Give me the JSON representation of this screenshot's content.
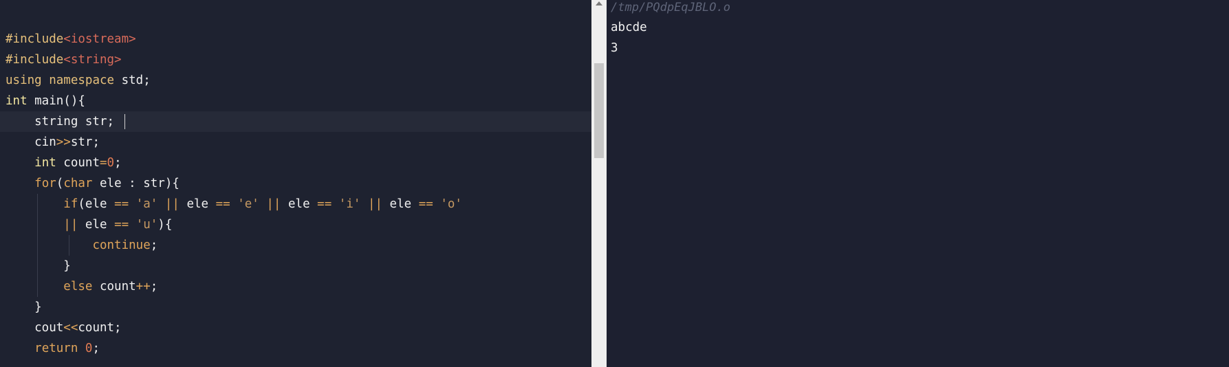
{
  "editor": {
    "lines": [
      [
        {
          "t": "#include",
          "c": "pp"
        },
        {
          "t": "<iostream>",
          "c": "inc"
        }
      ],
      [
        {
          "t": "#include",
          "c": "pp"
        },
        {
          "t": "<string>",
          "c": "inc"
        }
      ],
      [
        {
          "t": "using",
          "c": "kw-y"
        },
        {
          "t": " ",
          "c": "kw-w"
        },
        {
          "t": "namespace",
          "c": "kw-y"
        },
        {
          "t": " std;",
          "c": "kw-w"
        }
      ],
      [
        {
          "t": "int",
          "c": "tp"
        },
        {
          "t": " main(){",
          "c": "kw-w"
        }
      ],
      [
        {
          "t": "    string str;",
          "c": "kw-w"
        }
      ],
      [
        {
          "t": "    cin",
          "c": "kw-w"
        },
        {
          "t": ">>",
          "c": "op"
        },
        {
          "t": "str;",
          "c": "kw-w"
        }
      ],
      [
        {
          "t": "    ",
          "c": "kw-w"
        },
        {
          "t": "int",
          "c": "tp"
        },
        {
          "t": " count",
          "c": "kw-w"
        },
        {
          "t": "=",
          "c": "op"
        },
        {
          "t": "0",
          "c": "num"
        },
        {
          "t": ";",
          "c": "kw-w"
        }
      ],
      [
        {
          "t": "    ",
          "c": "kw-w"
        },
        {
          "t": "for",
          "c": "kw-o"
        },
        {
          "t": "(",
          "c": "kw-w"
        },
        {
          "t": "char",
          "c": "kw-o"
        },
        {
          "t": " ele : str){",
          "c": "kw-w"
        }
      ],
      [
        {
          "t": "        ",
          "c": "kw-w"
        },
        {
          "t": "if",
          "c": "kw-o"
        },
        {
          "t": "(ele ",
          "c": "kw-w"
        },
        {
          "t": "==",
          "c": "op"
        },
        {
          "t": " ",
          "c": "kw-w"
        },
        {
          "t": "'a'",
          "c": "str"
        },
        {
          "t": " ",
          "c": "kw-w"
        },
        {
          "t": "||",
          "c": "op"
        },
        {
          "t": " ele ",
          "c": "kw-w"
        },
        {
          "t": "==",
          "c": "op"
        },
        {
          "t": " ",
          "c": "kw-w"
        },
        {
          "t": "'e'",
          "c": "str"
        },
        {
          "t": " ",
          "c": "kw-w"
        },
        {
          "t": "||",
          "c": "op"
        },
        {
          "t": " ele ",
          "c": "kw-w"
        },
        {
          "t": "==",
          "c": "op"
        },
        {
          "t": " ",
          "c": "kw-w"
        },
        {
          "t": "'i'",
          "c": "str"
        },
        {
          "t": " ",
          "c": "kw-w"
        },
        {
          "t": "||",
          "c": "op"
        },
        {
          "t": " ele ",
          "c": "kw-w"
        },
        {
          "t": "==",
          "c": "op"
        },
        {
          "t": " ",
          "c": "kw-w"
        },
        {
          "t": "'o'",
          "c": "str"
        }
      ],
      [
        {
          "t": "        ",
          "c": "kw-w"
        },
        {
          "t": "||",
          "c": "op"
        },
        {
          "t": " ele ",
          "c": "kw-w"
        },
        {
          "t": "==",
          "c": "op"
        },
        {
          "t": " ",
          "c": "kw-w"
        },
        {
          "t": "'u'",
          "c": "str"
        },
        {
          "t": "){",
          "c": "kw-w"
        }
      ],
      [
        {
          "t": "            ",
          "c": "kw-w"
        },
        {
          "t": "continue",
          "c": "kw-o"
        },
        {
          "t": ";",
          "c": "kw-w"
        }
      ],
      [
        {
          "t": "        }",
          "c": "kw-w"
        }
      ],
      [
        {
          "t": "        ",
          "c": "kw-w"
        },
        {
          "t": "else",
          "c": "kw-o"
        },
        {
          "t": " count",
          "c": "kw-w"
        },
        {
          "t": "++",
          "c": "op"
        },
        {
          "t": ";",
          "c": "kw-w"
        }
      ],
      [
        {
          "t": "    }",
          "c": "kw-w"
        }
      ],
      [
        {
          "t": "    cout",
          "c": "kw-w"
        },
        {
          "t": "<<",
          "c": "op"
        },
        {
          "t": "count;",
          "c": "kw-w"
        }
      ],
      [
        {
          "t": "    ",
          "c": "kw-w"
        },
        {
          "t": "return",
          "c": "kw-o"
        },
        {
          "t": " ",
          "c": "kw-w"
        },
        {
          "t": "0",
          "c": "num"
        },
        {
          "t": ";",
          "c": "kw-w"
        }
      ]
    ]
  },
  "output": {
    "path": "/tmp/PQdpEqJBLO.o",
    "lines": [
      "abcde",
      "3"
    ]
  }
}
